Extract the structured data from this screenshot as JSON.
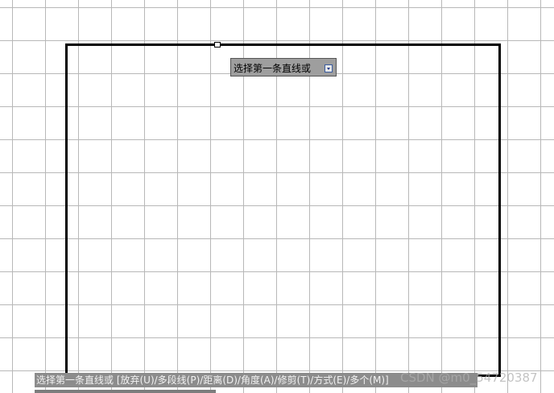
{
  "dynamic_input": {
    "prompt": "选择第一条直线或",
    "dropdown_icon": "down-arrow-icon"
  },
  "command_line": {
    "text": "选择第一条直线或 [放弃(U)/多段线(P)/距离(D)/角度(A)/修剪(T)/方式(E)/多个(M)]"
  },
  "watermark": {
    "text": "CSDN @m0_54720387"
  },
  "colors": {
    "grid": "#b8b8b8",
    "rectangle": "#000000",
    "tooltip_bg": "#9e9e9e",
    "command_bg": "#8c8c8c"
  }
}
